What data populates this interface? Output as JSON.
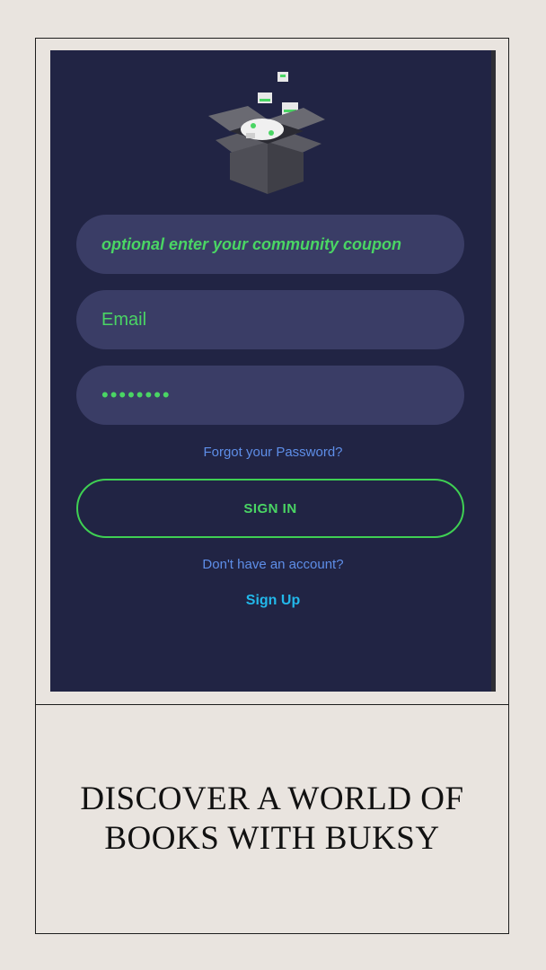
{
  "login": {
    "coupon_placeholder": "optional enter your community coupon",
    "email_placeholder": "Email",
    "password_value": "••••••••",
    "forgot_label": "Forgot your Password?",
    "signin_label": "SIGN IN",
    "no_account_label": "Don't have an account?",
    "signup_label": "Sign Up"
  },
  "caption": {
    "line1": "DISCOVER A WORLD OF",
    "line2": "BOOKS WITH BUKSY"
  },
  "colors": {
    "screen_bg": "#212444",
    "field_bg": "#3a3d66",
    "accent_green": "#4ad564",
    "link_blue": "#5e8ee8",
    "signup_cyan": "#22b8ea",
    "page_bg": "#e9e4df"
  }
}
